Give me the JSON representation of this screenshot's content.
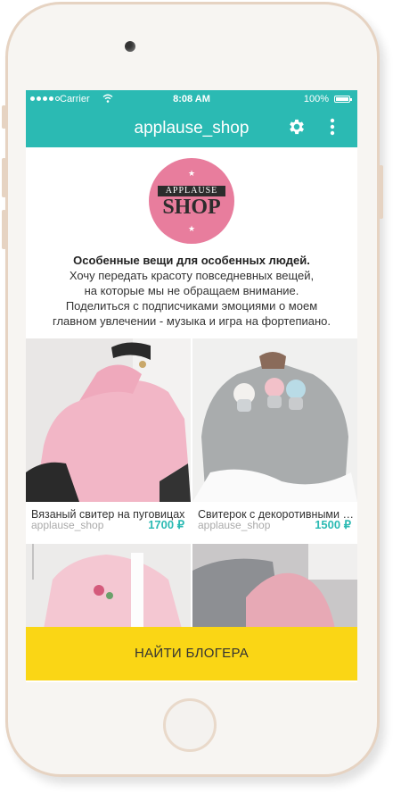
{
  "status_bar": {
    "carrier": "Carrier",
    "time": "8:08 AM",
    "battery": "100%"
  },
  "header": {
    "title": "applause_shop"
  },
  "logo": {
    "top_text": "APPLAUSE",
    "main_text": "SHOP"
  },
  "description": {
    "headline": "Особенные вещи для особенных людей.",
    "lines": [
      "Хочу передать красоту повседневных вещей,",
      "на которые мы не обращаем внимание.",
      "Поделиться с подписчиками эмоциями о моем",
      "главном увлечении - музыка и игра на фортепиано."
    ]
  },
  "products": [
    {
      "title": "Вязаный свитер на пуговицах",
      "shop": "applause_shop",
      "price": "1700 ₽"
    },
    {
      "title": "Свитерок с декоротивными шапками",
      "shop": "applause_shop",
      "price": "1500 ₽"
    }
  ],
  "cta": {
    "label": "НАЙТИ БЛОГЕРА"
  },
  "colors": {
    "accent": "#2bbab3",
    "cta": "#fad615",
    "logo": "#e87d9d"
  }
}
